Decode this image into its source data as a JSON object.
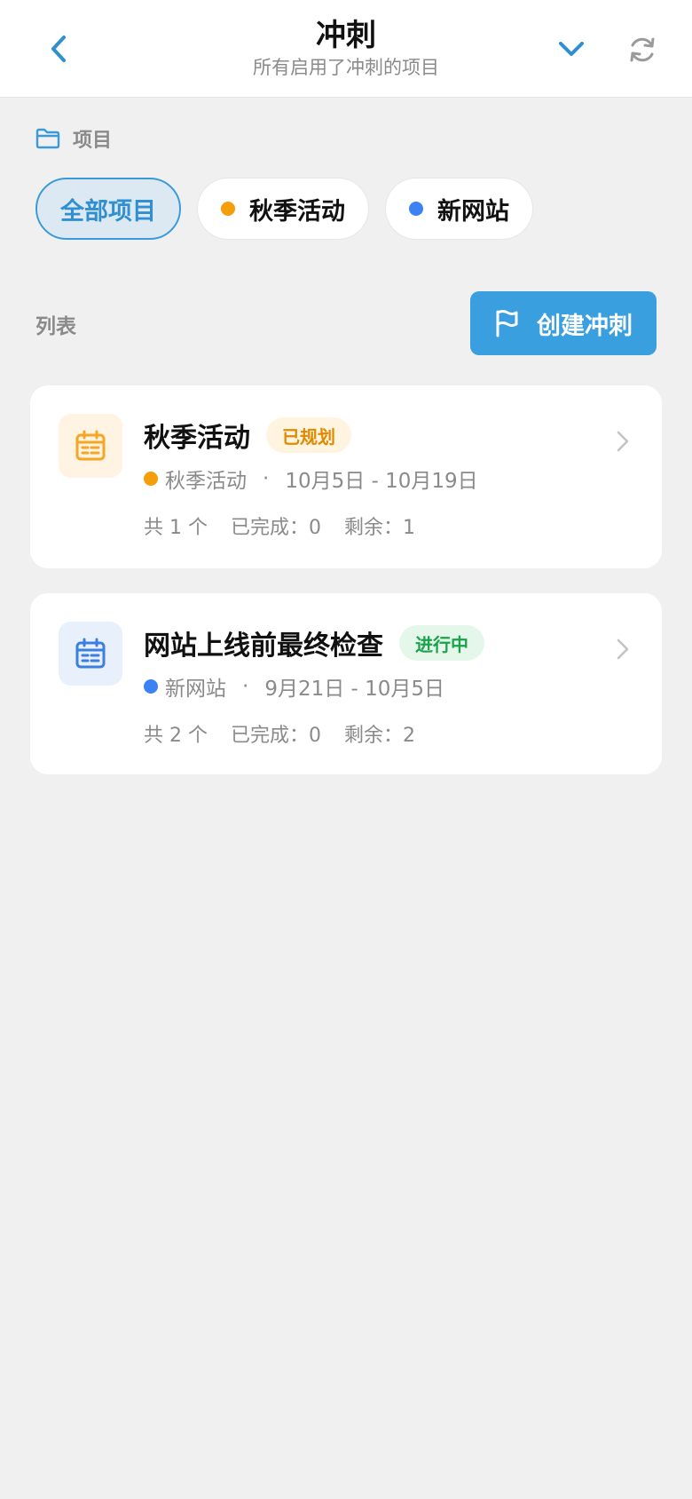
{
  "header": {
    "title": "冲刺",
    "subtitle": "所有启用了冲刺的项目"
  },
  "projects_section": {
    "label": "项目"
  },
  "filters": [
    {
      "label": "全部项目",
      "active": true,
      "dot_color": ""
    },
    {
      "label": "秋季活动",
      "active": false,
      "dot_color": "#f59e0b"
    },
    {
      "label": "新网站",
      "active": false,
      "dot_color": "#3b82f6"
    }
  ],
  "list": {
    "label": "列表",
    "create_label": "创建冲刺"
  },
  "sprints": [
    {
      "title": "秋季活动",
      "status": "已规划",
      "status_color": "#e08a00",
      "status_bg": "#fff4e0",
      "icon_color": "#f5a623",
      "icon_bg": "#fff3e3",
      "project": "秋季活动",
      "project_color": "#f59e0b",
      "date_range": "10月5日 - 10月19日",
      "total": "共 1 个",
      "completed": "已完成：0",
      "remaining": "剩余：1"
    },
    {
      "title": "网站上线前最终检查",
      "status": "进行中",
      "status_color": "#1aa34a",
      "status_bg": "#e5f7ea",
      "icon_color": "#3b7fe0",
      "icon_bg": "#e8f0fc",
      "project": "新网站",
      "project_color": "#3b82f6",
      "date_range": "9月21日 - 10月5日",
      "total": "共 2 个",
      "completed": "已完成：0",
      "remaining": "剩余：2"
    }
  ],
  "colors": {
    "accent": "#3a9fdf",
    "icon_blue": "#2f8fd0"
  }
}
